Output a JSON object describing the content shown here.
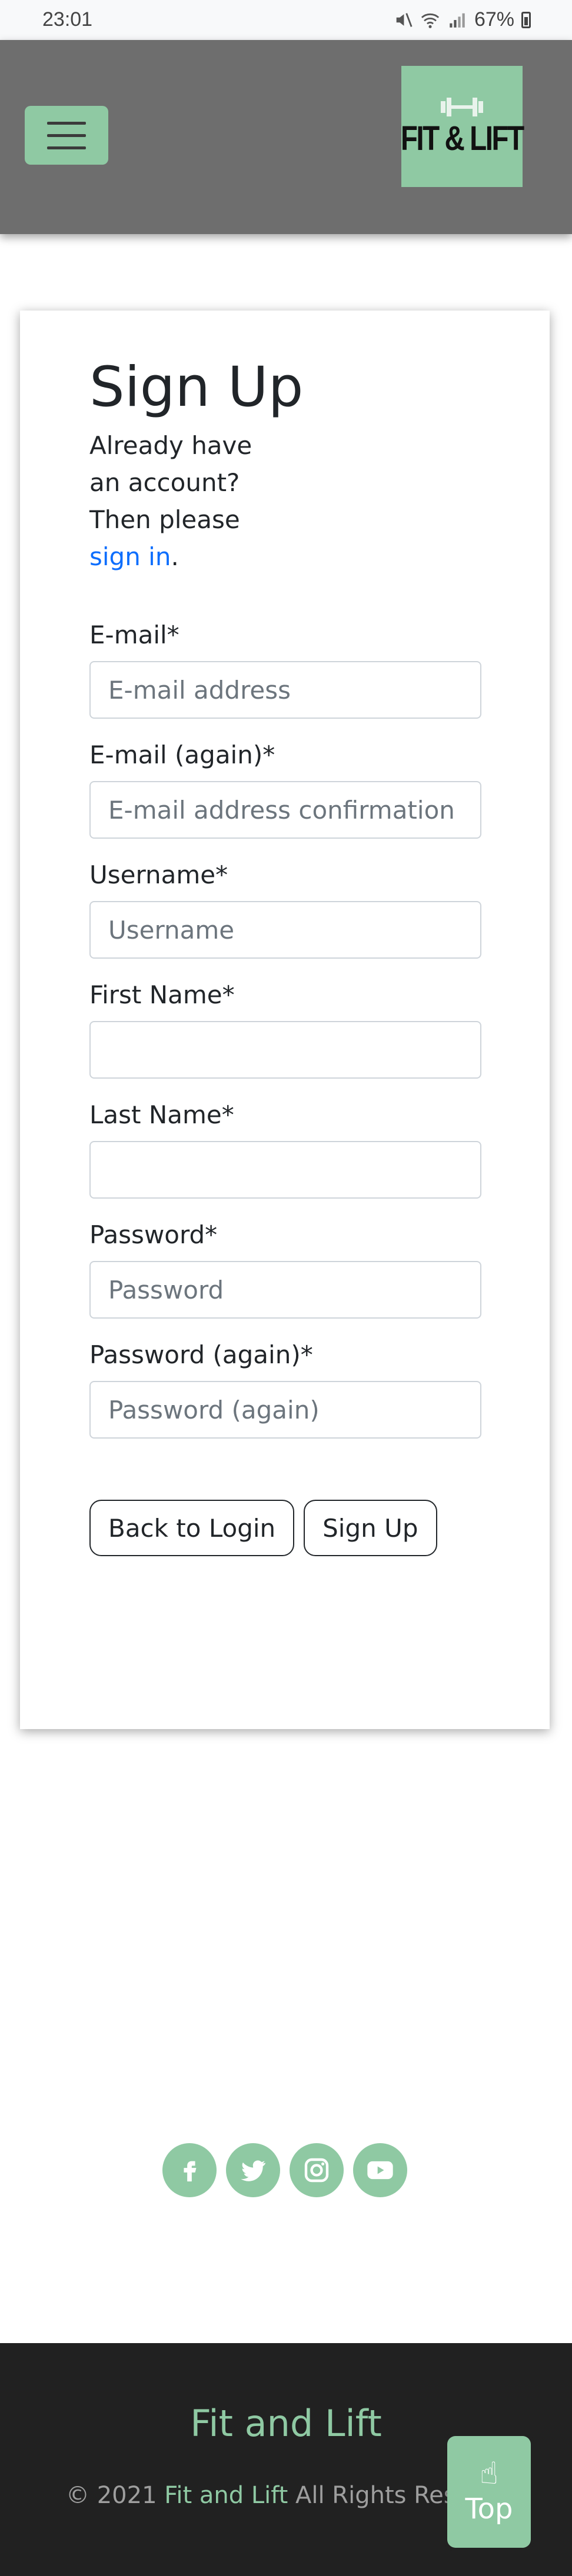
{
  "status_bar": {
    "time": "23:01",
    "battery": "67%",
    "icons": [
      "mute-icon",
      "wifi-icon",
      "signal-icon",
      "battery-icon"
    ]
  },
  "header": {
    "menu_icon": "hamburger-icon",
    "logo_text": "FIT & LIFT",
    "logo_icon": "dumbbell-icon"
  },
  "signup": {
    "title": "Sign Up",
    "intro_text": "Already have an account? Then please ",
    "signin_link": "sign in",
    "intro_end": ".",
    "fields": [
      {
        "label": "E-mail*",
        "placeholder": "E-mail address",
        "value": ""
      },
      {
        "label": "E-mail (again)*",
        "placeholder": "E-mail address confirmation",
        "value": ""
      },
      {
        "label": "Username*",
        "placeholder": "Username",
        "value": ""
      },
      {
        "label": "First Name*",
        "placeholder": "",
        "value": ""
      },
      {
        "label": "Last Name*",
        "placeholder": "",
        "value": ""
      },
      {
        "label": "Password*",
        "placeholder": "Password",
        "value": ""
      },
      {
        "label": "Password (again)*",
        "placeholder": "Password (again)",
        "value": ""
      }
    ],
    "back_button": "Back to Login",
    "signup_button": "Sign Up"
  },
  "social": [
    "facebook-icon",
    "twitter-icon",
    "instagram-icon",
    "youtube-icon"
  ],
  "footer": {
    "title": "Fit and Lift",
    "copy_prefix": "© 2021 ",
    "copy_brand": "Fit and Lift",
    "copy_suffix": " All Rights Rese",
    "top_button": "Top",
    "top_icon": "☝"
  },
  "colors": {
    "accent": "#8fc9a3",
    "header_bg": "#6e6e6e",
    "footer_bg": "#212121",
    "link": "#0d6efd"
  }
}
